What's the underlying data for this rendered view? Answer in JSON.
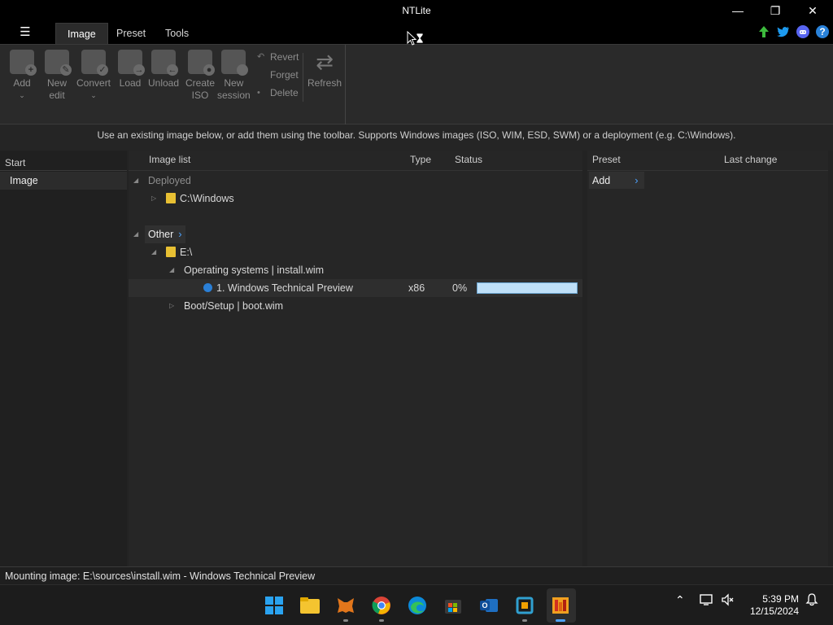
{
  "window": {
    "title": "NTLite",
    "minimize": "—",
    "maximize": "❐",
    "close": "✕"
  },
  "menu": {
    "hamburger": "☰"
  },
  "tabs": [
    {
      "label": "Image",
      "active": true
    },
    {
      "label": "Preset",
      "active": false
    },
    {
      "label": "Tools",
      "active": false
    }
  ],
  "top_icons": [
    "update-arrow-icon",
    "twitter-icon",
    "discord-icon",
    "help-icon"
  ],
  "ribbon": {
    "buttons": [
      {
        "label": "Add",
        "badge": "+",
        "caret": "⌄"
      },
      {
        "label": "New\nedit",
        "badge": ""
      },
      {
        "label": "Convert",
        "badge": "",
        "caret": "⌄"
      },
      {
        "label": "Load",
        "badge": ""
      },
      {
        "label": "Unload",
        "badge": ""
      },
      {
        "label": "Create\nISO",
        "badge": ""
      },
      {
        "label": "New\nsession",
        "badge": ""
      }
    ],
    "small": [
      {
        "label": "Revert",
        "icon": "↶"
      },
      {
        "label": "Forget",
        "icon": ""
      },
      {
        "label": "Delete",
        "icon": "•"
      }
    ],
    "refresh": "Refresh"
  },
  "info": "Use an existing image below, or add them using the toolbar. Supports Windows images (ISO, WIM, ESD, SWM) or a deployment (e.g. C:\\Windows).",
  "left": {
    "header": "Start",
    "item": "Image"
  },
  "image_list": {
    "headers": {
      "name": "Image list",
      "type": "Type",
      "status": "Status"
    },
    "deployed_group": "Deployed",
    "deployed_item": "C:\\Windows",
    "other_group": "Other",
    "drive": "E:\\",
    "os_node": "Operating systems  |  install.wim",
    "edition": "1. Windows Technical Preview",
    "edition_type": "x86",
    "edition_status": "0%",
    "edition_progress": 1.0,
    "boot_node": "Boot/Setup  |  boot.wim"
  },
  "preset": {
    "headers": {
      "preset": "Preset",
      "last_change": "Last change"
    },
    "add": "Add"
  },
  "status": "Mounting image: E:\\sources\\install.wim - Windows Technical Preview",
  "taskbar": {
    "time": "5:39 PM",
    "date": "12/15/2024"
  },
  "colors": {
    "accent": "#4da3ff",
    "folder": "#e8c033",
    "progress_fill": "#bfe0f8"
  }
}
